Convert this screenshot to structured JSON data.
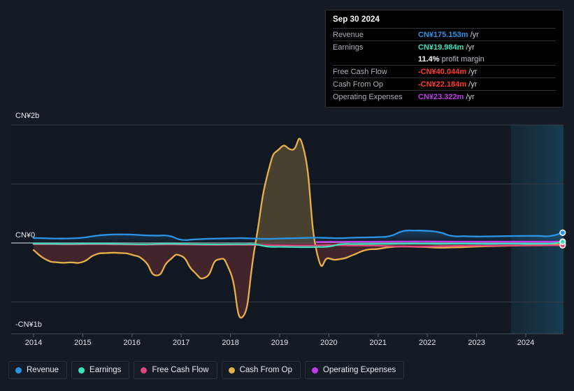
{
  "tooltip": {
    "date": "Sep 30 2024",
    "rows": [
      {
        "label": "Revenue",
        "value": "CN¥175.153m",
        "unit": "/yr",
        "color": "#2b93e8"
      },
      {
        "label": "Earnings",
        "value": "CN¥19.984m",
        "unit": "/yr",
        "color": "#3ce0bd"
      },
      {
        "label": "",
        "value": "11.4%",
        "unit": "profit margin",
        "color": "#ffffff"
      },
      {
        "label": "Free Cash Flow",
        "value": "-CN¥40.044m",
        "unit": "/yr",
        "color": "#ff3b30"
      },
      {
        "label": "Cash From Op",
        "value": "-CN¥22.184m",
        "unit": "/yr",
        "color": "#ff3b30"
      },
      {
        "label": "Operating Expenses",
        "value": "CN¥23.322m",
        "unit": "/yr",
        "color": "#c03ce8"
      }
    ]
  },
  "axis": {
    "y_top": "CN¥2b",
    "y_zero": "CN¥0",
    "y_bottom": "-CN¥1b",
    "x_labels": [
      "2014",
      "2015",
      "2016",
      "2017",
      "2018",
      "2019",
      "2020",
      "2021",
      "2022",
      "2023",
      "2024"
    ]
  },
  "legend": [
    {
      "label": "Revenue",
      "color": "#2b93e8"
    },
    {
      "label": "Earnings",
      "color": "#3ce0bd"
    },
    {
      "label": "Free Cash Flow",
      "color": "#e0457b"
    },
    {
      "label": "Cash From Op",
      "color": "#e8b04b"
    },
    {
      "label": "Operating Expenses",
      "color": "#c03ce8"
    }
  ],
  "chart_data": {
    "type": "area",
    "title": "",
    "xlabel": "",
    "ylabel": "CN¥",
    "ylim": [
      -1.4,
      2.0
    ],
    "yticks": [
      2.0,
      1.0,
      0.0,
      -1.0
    ],
    "ytick_labels": [
      "CN¥2b",
      "",
      "CN¥0",
      "-CN¥1b"
    ],
    "grid": true,
    "legend_position": "bottom",
    "units": "billions CN¥",
    "forecast_shading_starts": 2023.7,
    "x": [
      2014.0,
      2014.25,
      2014.5,
      2014.75,
      2015.0,
      2015.25,
      2015.5,
      2015.75,
      2016.0,
      2016.25,
      2016.5,
      2016.75,
      2017.0,
      2017.25,
      2017.5,
      2017.75,
      2018.0,
      2018.25,
      2018.5,
      2018.75,
      2019.0,
      2019.25,
      2019.5,
      2019.75,
      2020.0,
      2020.25,
      2020.5,
      2020.75,
      2021.0,
      2021.25,
      2021.5,
      2021.75,
      2022.0,
      2022.25,
      2022.5,
      2022.75,
      2023.0,
      2023.25,
      2023.5,
      2023.75,
      2024.0,
      2024.25,
      2024.5,
      2024.75
    ],
    "series": [
      {
        "name": "Revenue",
        "color": "#2b93e8",
        "values": [
          0.085,
          0.08,
          0.075,
          0.078,
          0.09,
          0.12,
          0.14,
          0.145,
          0.142,
          0.13,
          0.125,
          0.12,
          0.055,
          0.06,
          0.07,
          0.075,
          0.08,
          0.082,
          0.075,
          0.07,
          0.075,
          0.08,
          0.085,
          0.09,
          0.085,
          0.082,
          0.09,
          0.095,
          0.1,
          0.12,
          0.2,
          0.21,
          0.205,
          0.18,
          0.12,
          0.115,
          0.11,
          0.112,
          0.115,
          0.118,
          0.12,
          0.12,
          0.118,
          0.175
        ]
      },
      {
        "name": "Earnings",
        "color": "#3ce0bd",
        "values": [
          -0.01,
          -0.012,
          -0.014,
          -0.015,
          -0.012,
          -0.01,
          -0.012,
          -0.015,
          -0.018,
          -0.02,
          -0.015,
          -0.012,
          -0.015,
          -0.018,
          -0.02,
          -0.022,
          -0.02,
          -0.02,
          -0.022,
          -0.06,
          -0.065,
          -0.068,
          -0.07,
          -0.068,
          -0.06,
          -0.02,
          -0.018,
          -0.016,
          -0.015,
          -0.014,
          -0.012,
          -0.01,
          -0.012,
          -0.014,
          -0.012,
          -0.01,
          -0.012,
          -0.014,
          -0.012,
          -0.012,
          -0.014,
          -0.012,
          -0.01,
          0.02
        ]
      },
      {
        "name": "Free Cash Flow",
        "color": "#e0457b",
        "values": [
          -0.02,
          -0.02,
          -0.022,
          -0.024,
          -0.022,
          -0.02,
          -0.022,
          -0.024,
          -0.026,
          -0.028,
          -0.025,
          -0.024,
          -0.026,
          -0.028,
          -0.03,
          -0.032,
          -0.03,
          -0.03,
          -0.032,
          -0.035,
          -0.038,
          -0.04,
          -0.042,
          -0.04,
          -0.038,
          -0.04,
          -0.042,
          -0.044,
          -0.046,
          -0.055,
          -0.06,
          -0.062,
          -0.06,
          -0.055,
          -0.05,
          -0.048,
          -0.045,
          -0.046,
          -0.044,
          -0.042,
          -0.044,
          -0.042,
          -0.04,
          -0.04
        ]
      },
      {
        "name": "Cash From Op",
        "color": "#e8b04b",
        "values": [
          -0.12,
          -0.28,
          -0.33,
          -0.33,
          -0.32,
          -0.2,
          -0.17,
          -0.17,
          -0.2,
          -0.3,
          -0.55,
          -0.3,
          -0.22,
          -0.48,
          -0.58,
          -0.28,
          -0.5,
          -1.25,
          -0.05,
          1.15,
          1.6,
          1.58,
          1.55,
          -0.14,
          -0.26,
          -0.27,
          -0.2,
          -0.12,
          -0.1,
          -0.07,
          -0.06,
          -0.065,
          -0.07,
          -0.08,
          -0.075,
          -0.07,
          -0.06,
          -0.055,
          -0.05,
          -0.045,
          -0.04,
          -0.035,
          -0.03,
          -0.022
        ]
      },
      {
        "name": "Operating Expenses",
        "color": "#c03ce8",
        "values": [
          null,
          null,
          null,
          null,
          null,
          null,
          null,
          null,
          null,
          null,
          null,
          null,
          null,
          null,
          null,
          null,
          null,
          null,
          null,
          null,
          null,
          null,
          null,
          0.018,
          0.02,
          0.021,
          0.022,
          0.022,
          0.023,
          0.024,
          0.025,
          0.026,
          0.026,
          0.025,
          0.024,
          0.024,
          0.023,
          0.023,
          0.023,
          0.023,
          0.023,
          0.023,
          0.023,
          0.023
        ]
      }
    ]
  }
}
